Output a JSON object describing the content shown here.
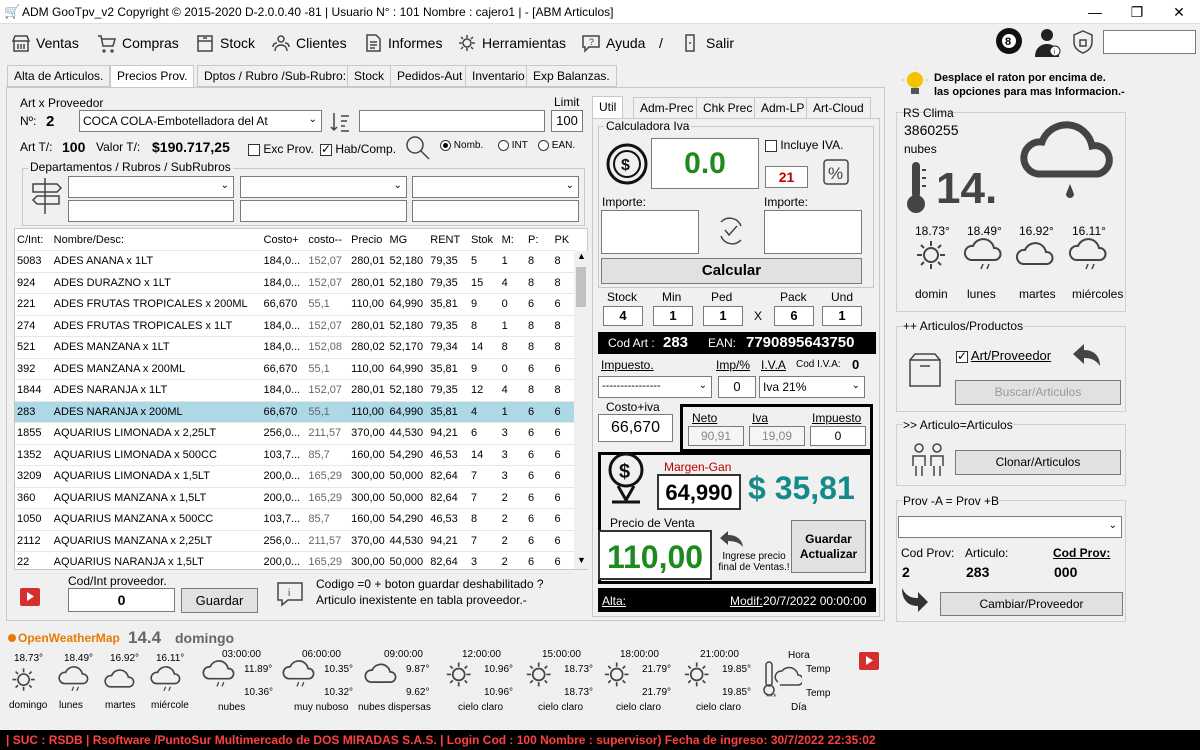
{
  "window": {
    "title": "ADM GooTpv_v2 Copyright ©  2015-2020 D-2.0.0.40 -81 | Usuario N° : 101 Nombre : cajero1 | - [ABM Articulos]"
  },
  "menu": [
    "Ventas",
    "Compras",
    "Stock",
    "Clientes",
    "Informes",
    "Herramientas",
    "Ayuda",
    "/",
    "Salir"
  ],
  "tabs": [
    "Alta de Articulos.",
    "Precios Prov.",
    "Dptos / Rubro /Sub-Rubro:",
    "Stock",
    "Pedidos-Aut",
    "Inventario",
    "Exp Balanzas."
  ],
  "prov": {
    "section": "Art x Proveedor",
    "limit_label": "Limit",
    "n_label": "Nº:",
    "n_value": "2",
    "prov_name": "COCA COLA-Embotelladora del At",
    "limit_value": "100",
    "art_t_label": "Art T/:",
    "art_t_value": "100",
    "valor_label": "Valor T/:",
    "valor_value": "$190.717,25",
    "exc_prov": "Exc Prov.",
    "hab_comp": "Hab/Comp.",
    "radio_nomb": "Nomb.",
    "radio_int": "INT",
    "radio_ean": "EAN.",
    "dept_label": "Departamentos / Rubros / SubRubros"
  },
  "grid": {
    "headers": [
      "C/Int:",
      "Nombre/Desc:",
      "Costo+",
      "costo--",
      "Precio",
      "MG",
      "RENT",
      "Stok",
      "M:",
      "P:",
      "PK"
    ],
    "rows": [
      [
        "5083",
        "ADES ANANA  x 1LT",
        "184,0...",
        "152,07",
        "280,01",
        "52,180",
        "79,35",
        "5",
        "1",
        "8",
        "8"
      ],
      [
        "924",
        "ADES DURAZNO  x 1LT",
        "184,0...",
        "152,07",
        "280,01",
        "52,180",
        "79,35",
        "15",
        "4",
        "8",
        "8"
      ],
      [
        "221",
        "ADES FRUTAS TROPICALES  x 200ML",
        "66,670",
        "55,1",
        "110,00",
        "64,990",
        "35,81",
        "9",
        "0",
        "6",
        "6"
      ],
      [
        "274",
        "ADES FRUTAS TROPICALES  x 1LT",
        "184,0...",
        "152,07",
        "280,01",
        "52,180",
        "79,35",
        "8",
        "1",
        "8",
        "8"
      ],
      [
        "521",
        "ADES MANZANA  x 1LT",
        "184,0...",
        "152,08",
        "280,02",
        "52,170",
        "79,34",
        "14",
        "8",
        "8",
        "8"
      ],
      [
        "392",
        "ADES MANZANA  x 200ML",
        "66,670",
        "55,1",
        "110,00",
        "64,990",
        "35,81",
        "9",
        "0",
        "6",
        "6"
      ],
      [
        "1844",
        "ADES NARANJA  x 1LT",
        "184,0...",
        "152,07",
        "280,01",
        "52,180",
        "79,35",
        "12",
        "4",
        "8",
        "8"
      ],
      [
        "283",
        "ADES NARANJA  x 200ML",
        "66,670",
        "55,1",
        "110,00",
        "64,990",
        "35,81",
        "4",
        "1",
        "6",
        "6"
      ],
      [
        "1855",
        "AQUARIUS LIMONADA  x 2,25LT",
        "256,0...",
        "211,57",
        "370,00",
        "44,530",
        "94,21",
        "6",
        "3",
        "6",
        "6"
      ],
      [
        "1352",
        "AQUARIUS LIMONADA  x 500CC",
        "103,7...",
        "85,7",
        "160,00",
        "54,290",
        "46,53",
        "14",
        "3",
        "6",
        "6"
      ],
      [
        "3209",
        "AQUARIUS LIMONADA  x 1,5LT",
        "200,0...",
        "165,29",
        "300,00",
        "50,000",
        "82,64",
        "7",
        "3",
        "6",
        "6"
      ],
      [
        "360",
        "AQUARIUS MANZANA  x 1,5LT",
        "200,0...",
        "165,29",
        "300,00",
        "50,000",
        "82,64",
        "7",
        "2",
        "6",
        "6"
      ],
      [
        "1050",
        "AQUARIUS MANZANA  x 500CC",
        "103,7...",
        "85,7",
        "160,00",
        "54,290",
        "46,53",
        "8",
        "2",
        "6",
        "6"
      ],
      [
        "2112",
        "AQUARIUS MANZANA  x 2,25LT",
        "256,0...",
        "211,57",
        "370,00",
        "44,530",
        "94,21",
        "7",
        "2",
        "6",
        "6"
      ],
      [
        "22",
        "AQUARIUS NARANJA  x 1,5LT",
        "200,0...",
        "165,29",
        "300,00",
        "50,000",
        "82,64",
        "3",
        "2",
        "6",
        "6"
      ]
    ],
    "selected": 7
  },
  "bottom_left": {
    "cod_label": "Cod/Int proveedor.",
    "cod_value": "0",
    "save": "Guardar",
    "msg1": "Codigo =0 + boton guardar deshabilitado ?",
    "msg2": "Articulo inexistente en tabla proveedor.-"
  },
  "right_tabs": [
    "Util",
    "Adm-Prec",
    "Chk Prec",
    "Adm-LP",
    "Art-Cloud"
  ],
  "calc": {
    "title": "Calculadora Iva",
    "value": "0.0",
    "incluye": "Incluye IVA.",
    "iva_pct": "21",
    "importe1": "Importe:",
    "importe2": "Importe:",
    "calcular": "Calcular",
    "stock_l": "Stock",
    "min_l": "Min",
    "ped_l": "Ped",
    "pack_l": "Pack",
    "und_l": "Und",
    "stock": "4",
    "min": "1",
    "ped": "1",
    "x": "X",
    "pack": "6",
    "und": "1",
    "codart_l": "Cod Art :",
    "codart": "283",
    "ean_l": "EAN:",
    "ean": "7790895643750",
    "impuesto_l": "Impuesto.",
    "imp_pct_l": "Imp/%",
    "iva_l": "I.V.A",
    "codiva_l": "Cod I.V.A:",
    "codiva": "0",
    "impuesto_sel": "----------------",
    "imp_pct": "0",
    "iva_sel": "Iva 21%",
    "costo_iva_l": "Costo+iva",
    "costo_iva": "66,670",
    "neto_l": "Neto",
    "iva2_l": "Iva",
    "impuesto2_l": "Impuesto",
    "neto": "90,91",
    "iva2": "19,09",
    "impuesto2": "0",
    "margen_l": "Margen-Gan",
    "margen": "64,990",
    "gan": "$ 35,81",
    "pv_l": "Precio de Venta",
    "pv": "110,00",
    "hint": "Ingrese precio final de Ventas.!",
    "guardar": "Guardar Actualizar",
    "alta_l": "Alta:",
    "modif_l": "Modif:",
    "modif": "20/7/2022 00:00:00"
  },
  "info": {
    "line1": "Desplace el raton por encima de.",
    "line2": "las opciones para mas Informacion.-"
  },
  "weather": {
    "rs": "RS Clima",
    "code": "3860255",
    "desc": "nubes",
    "temp": "14.",
    "days": [
      {
        "t": "18.73°",
        "d": "domin"
      },
      {
        "t": "18.49°",
        "d": "lunes"
      },
      {
        "t": "16.92°",
        "d": "martes"
      },
      {
        "t": "16.11°",
        "d": "miércoles"
      }
    ]
  },
  "art_prod": {
    "title": "++ Articulos/Productos",
    "chk": "Art/Proveedor",
    "buscar": "Buscar/Articulos"
  },
  "art_art": {
    "title": ">> Articulo=Articulos",
    "clonar": "Clonar/Articulos"
  },
  "prov_ab": {
    "title": "Prov -A = Prov +B",
    "codprov_l": "Cod Prov:",
    "articulo_l": "Articulo:",
    "codprov2_l": "Cod Prov:",
    "codprov": "2",
    "articulo": "283",
    "codprov2": "000",
    "cambiar": "Cambiar/Proveedor"
  },
  "forecast": {
    "brand": "OpenWeatherMap",
    "temp": "14.4",
    "day": "domingo",
    "days": [
      {
        "t": "18.73°",
        "d": "domingo"
      },
      {
        "t": "18.49°",
        "d": "lunes"
      },
      {
        "t": "16.92°",
        "d": "martes"
      },
      {
        "t": "16.11°",
        "d": "miércole"
      }
    ],
    "hours": [
      {
        "h": "03:00:00",
        "a": "11.89°",
        "b": "10.36°",
        "d": "nubes"
      },
      {
        "h": "06:00:00",
        "a": "10.35°",
        "b": "10.32°",
        "d": "muy nuboso"
      },
      {
        "h": "09:00:00",
        "a": "9.87°",
        "b": "9.62°",
        "d": "nubes dispersas"
      },
      {
        "h": "12:00:00",
        "a": "10.96°",
        "b": "10.96°",
        "d": "cielo claro"
      },
      {
        "h": "15:00:00",
        "a": "18.73°",
        "b": "18.73°",
        "d": "cielo claro"
      },
      {
        "h": "18:00:00",
        "a": "21.79°",
        "b": "21.79°",
        "d": "cielo claro"
      },
      {
        "h": "21:00:00",
        "a": "19.85°",
        "b": "19.85°",
        "d": "cielo claro"
      }
    ],
    "hora": "Hora",
    "temp_l": "Temp",
    "temp_l2": "Temp",
    "dia": "Día"
  },
  "status": "| SUC : RSDB | Rsoftware /PuntoSur Multimercado de DOS MIRADAS S.A.S. | Login Cod : 100 Nombre : supervisor) Fecha de ingreso: 30/7/2022 22:35:02"
}
